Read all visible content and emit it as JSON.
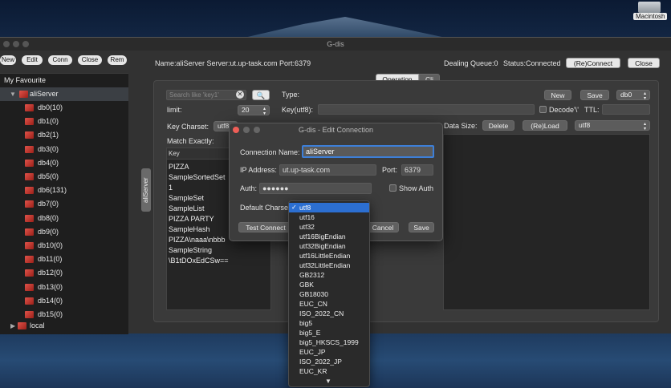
{
  "desktop": {
    "drive_label": "Macintosh"
  },
  "window": {
    "title": "G-dis",
    "toolbar": [
      "New",
      "Edit",
      "Conn",
      "Close",
      "Rem"
    ]
  },
  "sidebar": {
    "header": "My Favourite",
    "server": "aliServer",
    "vertical_tab": "aliServer",
    "dbs": [
      "db0(10)",
      "db1(0)",
      "db2(1)",
      "db3(0)",
      "db4(0)",
      "db5(0)",
      "db6(131)",
      "db7(0)",
      "db8(0)",
      "db9(0)",
      "db10(0)",
      "db11(0)",
      "db12(0)",
      "db13(0)",
      "db14(0)",
      "db15(0)"
    ],
    "local": "local"
  },
  "header": {
    "info": "Name:aliServer Server:ut.up-task.com Port:6379",
    "queue": "Dealing Queue:0",
    "status": "Status:Connected",
    "reconnect": "(Re)Connect",
    "close": "Close"
  },
  "tabs": {
    "operation": "Operation",
    "cli": "Cli"
  },
  "operation": {
    "search_placeholder": "Search like 'key1'",
    "limit_label": "limit:",
    "limit_value": "20",
    "key_charset_label": "Key Charset:",
    "key_charset_value": "utf8",
    "match_exactly": "Match Exactly:",
    "key_header": "Key",
    "keys": [
      "PIZZA",
      "SampleSortedSet",
      "1",
      "SampleSet",
      "SampleList",
      "PIZZA PARTY",
      "SampleHash",
      "PIZZA\\naaa\\nbbb",
      "SampleString",
      "\\B1tDOxEdCSw=="
    ],
    "type_label": "Type:",
    "new_btn": "New",
    "save_btn": "Save",
    "db_select": "db0",
    "key_utf8_label": "Key(utf8):",
    "decode_label": "Decode'\\'",
    "ttl_label": "TTL:",
    "data_size_label": "Data Size:",
    "delete_btn": "Delete",
    "reload_btn": "(Re)Load",
    "value_charset": "utf8"
  },
  "dialog": {
    "title": "G-dis - Edit Connection",
    "conn_name_label": "Connection Name:",
    "conn_name_value": "aliServer",
    "ip_label": "IP Address:",
    "ip_value": "ut.up-task.com",
    "port_label": "Port:",
    "port_value": "6379",
    "auth_label": "Auth:",
    "auth_value": "●●●●●●",
    "show_auth": "Show Auth",
    "charset_label": "Default Charset",
    "test_btn": "Test Connect",
    "cancel_btn": "Cancel",
    "save_btn": "Save"
  },
  "charsets": {
    "selected": "utf8",
    "options": [
      "utf8",
      "utf16",
      "utf32",
      "utf16BigEndian",
      "utf32BigEndian",
      "utf16LittleEndian",
      "utf32LittleEndian",
      "GB2312",
      "GBK",
      "GB18030",
      "EUC_CN",
      "ISO_2022_CN",
      "big5",
      "big5_E",
      "big5_HKSCS_1999",
      "EUC_JP",
      "ISO_2022_JP",
      "EUC_KR"
    ]
  },
  "colors": {
    "accent": "#2c6fd1",
    "db_icon": "#c9342b"
  }
}
